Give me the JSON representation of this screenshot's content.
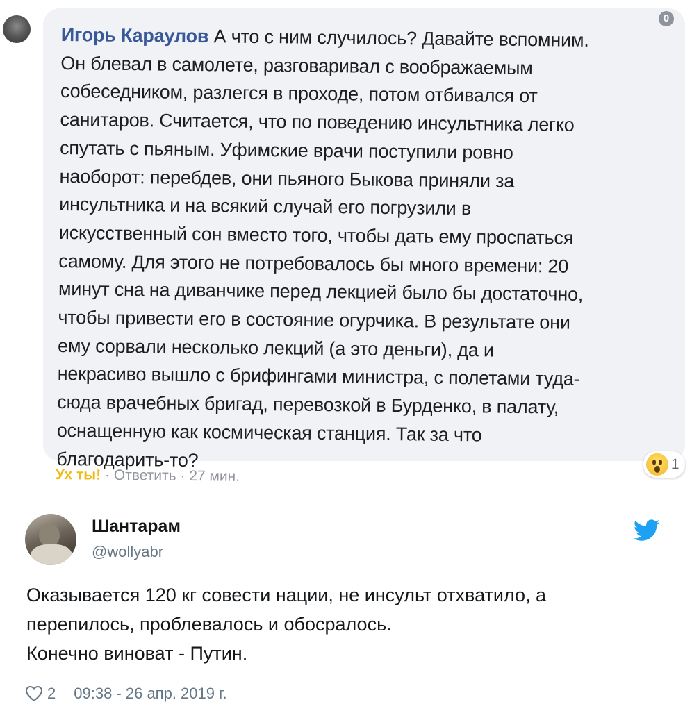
{
  "fb_comment": {
    "author": "Игорь Караулов",
    "lines": [
      "А что с ним случилось? Давайте вспомним.",
      "Он блевал в самолете, разговаривал с воображаемым",
      "собеседником, разлегся в проходе, потом отбивался от",
      "санитаров. Считается, что по поведению инсультника легко",
      "спутать с пьяным. Уфимские врачи поступили ровно",
      "наоборот: перебдев, они пьяного Быкова приняли за",
      "инсультника и на всякий случай его погрузили в",
      "искусственный сон вместо того, чтобы дать ему проспаться",
      "самому. Для этого не потребовалось бы много времени: 20",
      "минут сна на диванчике перед лекцией было бы достаточно,",
      "чтобы привести его в состояние огурчика. В результате они",
      "ему сорвали несколько лекций (а это деньги), да и",
      "некрасиво вышло с брифингами министра, с полетами туда-",
      "сюда врачебных бригад, перевозкой в Бурденко, в палату,",
      "оснащенную как космическая станция. Так за что",
      "благодарить-то?"
    ],
    "info_icon_glyph": "0",
    "wow_label": "Ух ты!",
    "separator": " · ",
    "reply_label": "Ответить",
    "time": "27 мин.",
    "reaction_icon": "wow-emoji-icon",
    "reaction_count": "1",
    "colors": {
      "author": "#385898",
      "bubble": "#f1f2f5",
      "wow": "#f0ba15"
    }
  },
  "tweet": {
    "name": "Шантарам",
    "handle": "@wollyabr",
    "lines": [
      "Оказывается 120 кг совести нации, не инсульт отхватило, а",
      "перепилось, проблевалось и обосралось.",
      "Конечно виноват - Путин."
    ],
    "likes": "2",
    "timestamp": "09:38 - 26 апр. 2019 г.",
    "icons": {
      "bird": "twitter-bird-icon",
      "like": "heart-icon"
    },
    "colors": {
      "bird": "#1da1f2",
      "secondary_text": "#657786"
    }
  }
}
